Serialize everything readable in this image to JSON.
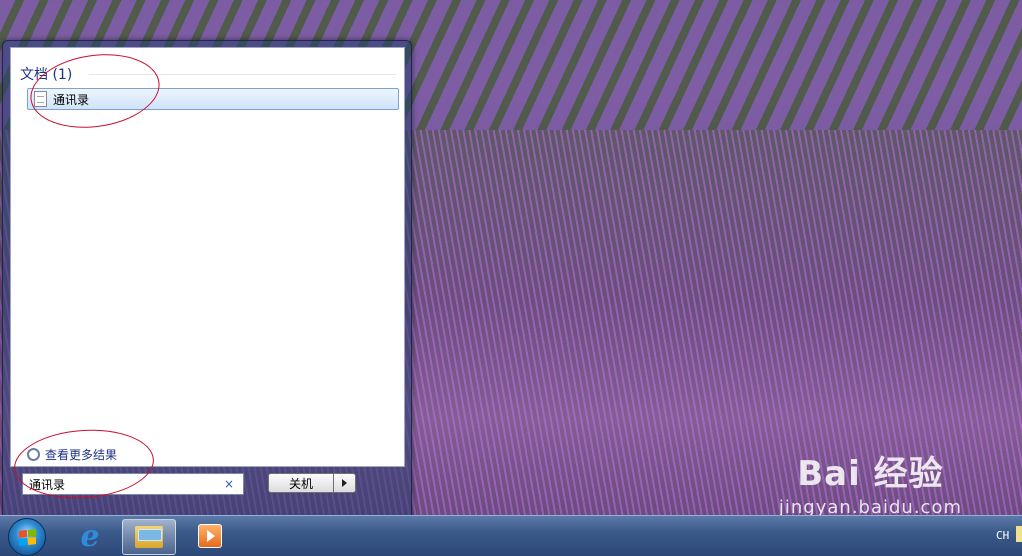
{
  "start_menu": {
    "results_heading": "文档 (1)",
    "results": [
      {
        "label": "通讯录",
        "icon": "document-icon"
      }
    ],
    "see_more": "查看更多结果",
    "search": {
      "value": "通讯录",
      "clear_glyph": "×"
    },
    "shutdown_label": "关机"
  },
  "taskbar": {
    "items": [
      "start-orb",
      "internet-explorer-icon",
      "windows-explorer-icon",
      "media-player-icon"
    ],
    "language": "CH"
  },
  "watermark": {
    "brand": "Bai 经验",
    "url": "jingyan.baidu.com"
  },
  "colors": {
    "accent_text": "#1e3287",
    "annotation": "#c8102e",
    "selection": "#cfe3fa"
  }
}
